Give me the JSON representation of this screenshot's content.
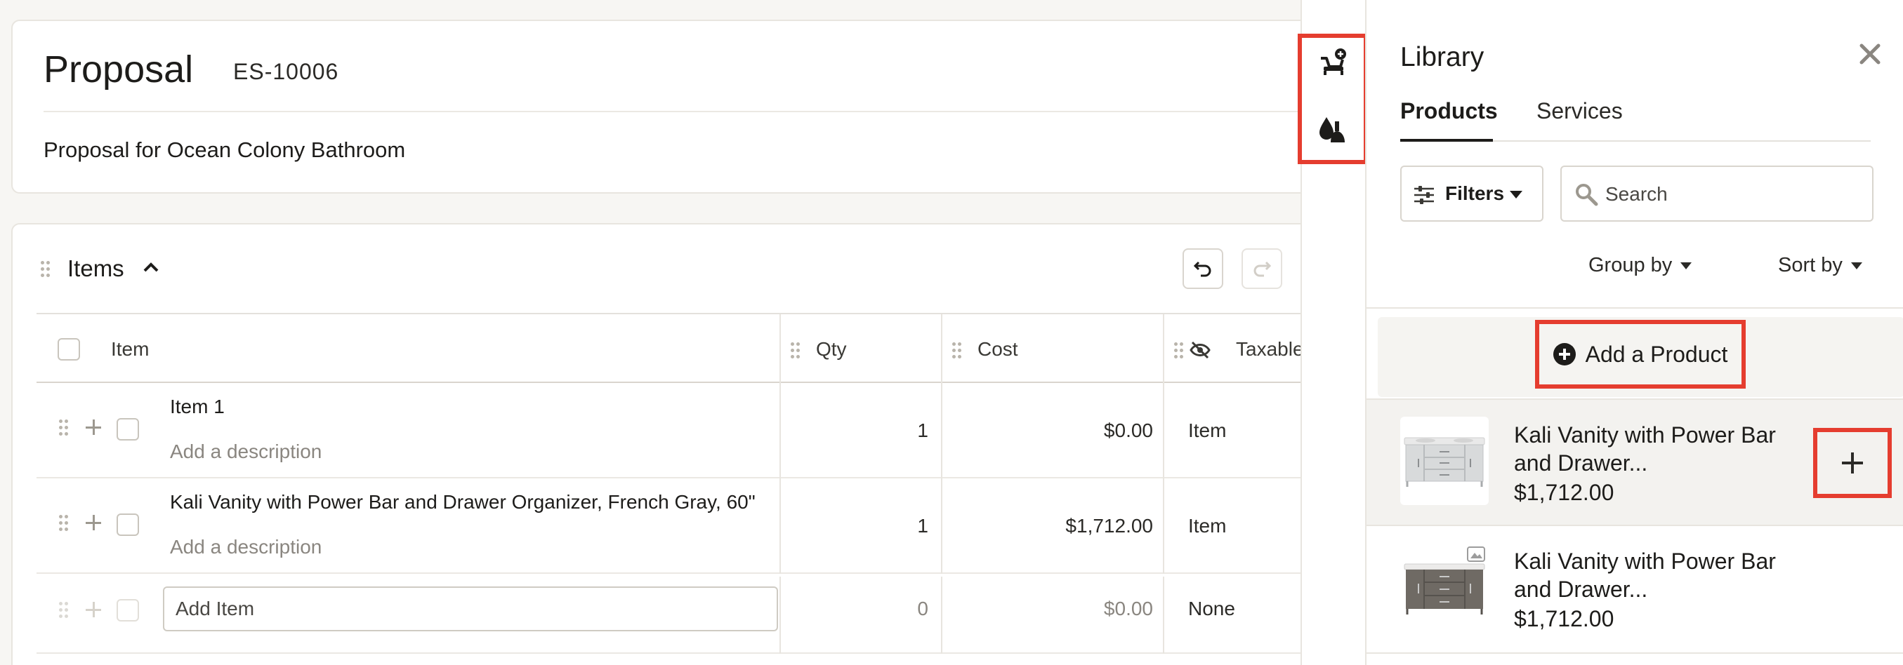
{
  "proposal": {
    "title": "Proposal",
    "number": "ES-10006",
    "subtitle": "Proposal for Ocean Colony Bathroom"
  },
  "items_section": {
    "title": "Items",
    "columns": {
      "item": "Item",
      "qty": "Qty",
      "cost": "Cost",
      "taxable": "Taxable"
    },
    "rows": [
      {
        "name": "Item 1",
        "description_placeholder": "Add a description",
        "qty": "1",
        "cost": "$0.00",
        "taxable": "Item"
      },
      {
        "name": "Kali Vanity with Power Bar and Drawer Organizer, French Gray, 60\"",
        "description_placeholder": "Add a description",
        "qty": "1",
        "cost": "$1,712.00",
        "taxable": "Item"
      }
    ],
    "new_row": {
      "placeholder": "Add Item",
      "qty": "0",
      "cost": "$0.00",
      "taxable": "None"
    }
  },
  "rail": {
    "icons": [
      "add-furniture-icon",
      "plumbing-icon"
    ]
  },
  "library": {
    "title": "Library",
    "tabs": [
      {
        "label": "Products",
        "active": true
      },
      {
        "label": "Services",
        "active": false
      }
    ],
    "filters_label": "Filters",
    "search_placeholder": "Search",
    "group_by_label": "Group by",
    "sort_by_label": "Sort by",
    "add_product_label": "Add a Product",
    "products": [
      {
        "name": "Kali Vanity with Power Bar and Drawer...",
        "price": "$1,712.00",
        "finish": "gray"
      },
      {
        "name": "Kali Vanity with Power Bar and Drawer...",
        "price": "$1,712.00",
        "finish": "wood"
      }
    ]
  },
  "colors": {
    "highlight": "#e53d2f",
    "background": "#f7f6f3",
    "text": "#1d1c1a"
  }
}
